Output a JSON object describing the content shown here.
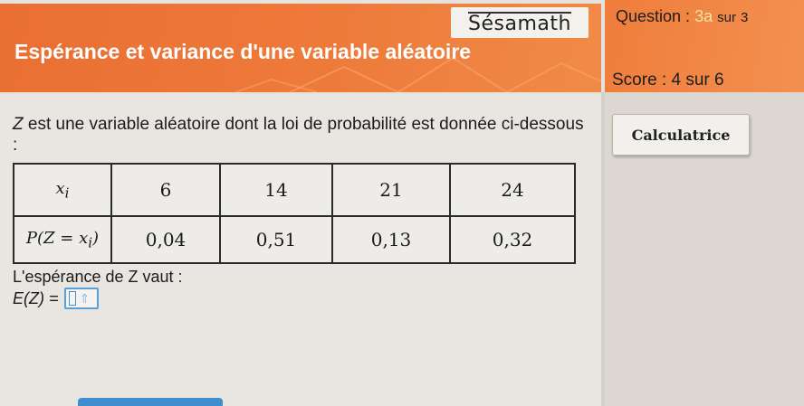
{
  "brand": "Sésamath",
  "exercise_title": "Espérance et variance d'une variable aléatoire",
  "question": {
    "prefix": "Question :",
    "current": "3a",
    "sur": "sur",
    "total": "3"
  },
  "score": "Score : 4 sur 6",
  "calculator_button": "Calculatrice",
  "statement": {
    "var": "Z",
    "text": " est une variable aléatoire dont la loi de probabilité est donnée ci-dessous :"
  },
  "table": {
    "row1_head": "x",
    "row1_sub": "i",
    "row2_head": "P(Z = x",
    "row2_sub": "i",
    "row2_tail": ")",
    "values": [
      "6",
      "14",
      "21",
      "24"
    ],
    "probabilities": [
      "0,04",
      "0,51",
      "0,13",
      "0,32"
    ]
  },
  "prompt": "L'espérance de Z vaut :",
  "answer": {
    "label": "E(Z) =",
    "value": ""
  },
  "colors": {
    "banner": "#e96f33",
    "input_border": "#5aa0d8",
    "current_question": "#f2e4a2"
  },
  "icons": {
    "cursor": "text-cursor-icon",
    "arrow": "up-arrow-icon"
  }
}
